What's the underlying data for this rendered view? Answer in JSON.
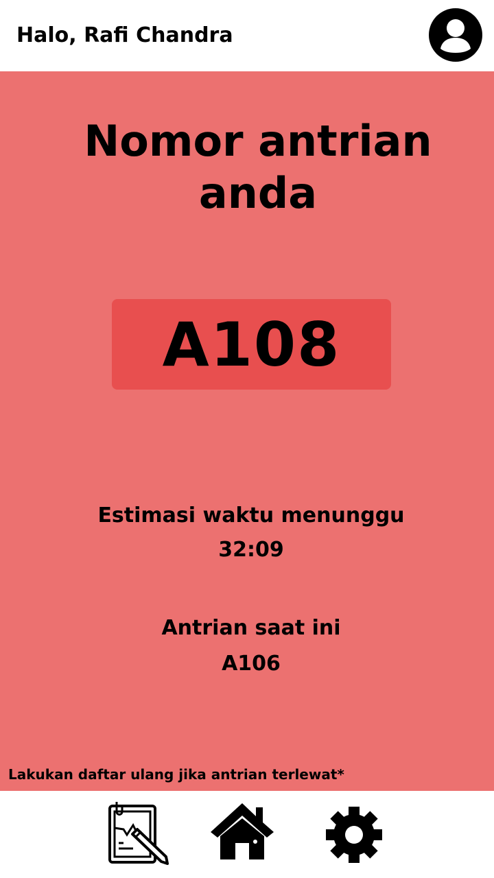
{
  "header": {
    "greeting": "Halo, Rafi Chandra",
    "avatar_icon": "user-avatar-icon"
  },
  "main": {
    "title": "Nomor antrian anda",
    "ticket_number": "A108",
    "estimate_label": "Estimasi waktu menunggu",
    "estimate_value": "32:09",
    "current_label": "Antrian saat ini",
    "current_value": "A106",
    "note": "Lakukan daftar ulang jika antrian terlewat*"
  },
  "nav": {
    "items": [
      {
        "icon": "form-edit-icon"
      },
      {
        "icon": "home-icon"
      },
      {
        "icon": "gear-icon"
      }
    ]
  },
  "colors": {
    "background": "#ec7170",
    "ticket_box": "#e84f4f",
    "header": "#ffffff",
    "text": "#000000"
  }
}
